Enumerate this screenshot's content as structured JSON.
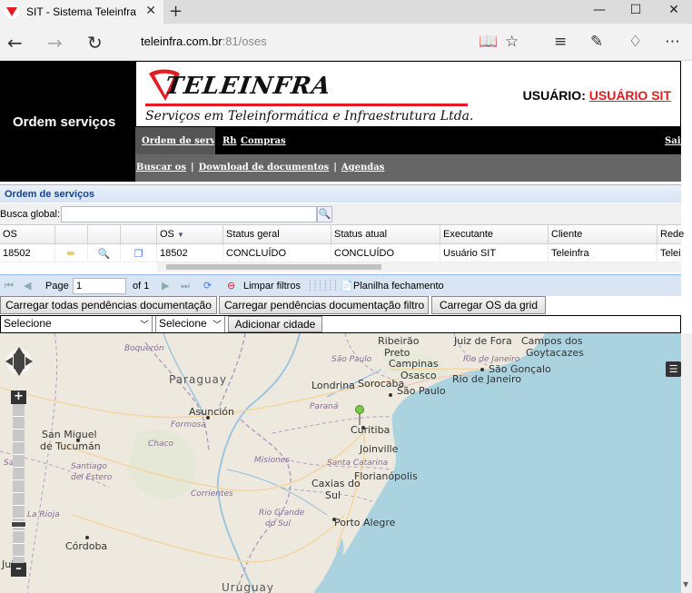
{
  "browser": {
    "tab_title": "SIT - Sistema Teleinfra",
    "url_host": "teleinfra.com.br",
    "url_path": ":81/oses"
  },
  "page": {
    "section_title": "Ordem serviços",
    "logo_text": "TELEINFRA",
    "slogan": "Serviços em Teleinformática e Infraestrutura Ltda.",
    "user_label": "USUÁRIO:",
    "user_name": "USUÁRIO SIT",
    "menu1": [
      "Ordem de serviço",
      "Rh",
      "Compras"
    ],
    "logout": "Sair",
    "menu2": [
      "Buscar os",
      "Download de documentos",
      "Agendas"
    ]
  },
  "grid": {
    "title": "Ordem de serviços",
    "search_label": "Busca global:",
    "columns": [
      "OS",
      "",
      "",
      "",
      "OS",
      "Status geral",
      "Status atual",
      "Executante",
      "Cliente",
      "Rede"
    ],
    "row": {
      "os": "18502",
      "os2": "18502",
      "status_geral": "CONCLUÍDO",
      "status_atual": "CONCLUÍDO",
      "executante": "Usuário SIT",
      "cliente": "Teleinfra",
      "rede": "Telei"
    },
    "pager": {
      "page_label": "Page",
      "page_value": "1",
      "of_label": "of 1",
      "clear_filters": "Limpar filtros",
      "spreadsheet": "Planilha fechamento"
    }
  },
  "actions": {
    "load_all": "Carregar todas pendências documentação",
    "load_filter": "Carregar pendências documentação filtro",
    "load_grid": "Carregar OS da grid"
  },
  "filters": {
    "select1": "Selecione",
    "select2": "Selecione",
    "add_city": "Adicionar cidade"
  },
  "map": {
    "labels": {
      "boqueron": "Boquerón",
      "paraguay": "Paraguay",
      "asuncion": "Asunción",
      "san_miguel": "San Miguel",
      "de_tucuman": "de Tucumán",
      "chaco": "Chaco",
      "formosa": "Formosa",
      "salta": "Salta",
      "santiago": "Santiago",
      "del_estero": "del Estero",
      "corrientes": "Corrientes",
      "cordoba": "Córdoba",
      "la_rioja": "La Rioja",
      "misiones": "Misiones",
      "uruguay": "Uruguay",
      "ribeirao": "Ribeirão",
      "preto": "Preto",
      "campinas": "Campinas",
      "osasco": "Osasco",
      "sao_paulo": "São Paulo",
      "sao_paulo_state": "São Paulo",
      "londrina": "Londrina",
      "sorocaba": "Sorocaba",
      "parana": "Paraná",
      "curitiba": "Curitiba",
      "joinville": "Joinville",
      "santa_catarina": "Santa Catarina",
      "florianopolis": "Florianópolis",
      "caxias": "Caxias do",
      "sul": "Sul",
      "rio_grande": "Rio Grande",
      "do_sul": "do Sul",
      "porto_alegre": "Porto Alegre",
      "juiz_de_fora": "Juiz de Fora",
      "campos": "Campos dos",
      "goytacazes": "Goytacazes",
      "rio_de_janeiro_state": "Rio de Janeiro",
      "sao_goncalo": "São Gonçalo",
      "rio_de_janeiro": "Rio de Janeiro",
      "jujuy": "Jujuy"
    }
  }
}
